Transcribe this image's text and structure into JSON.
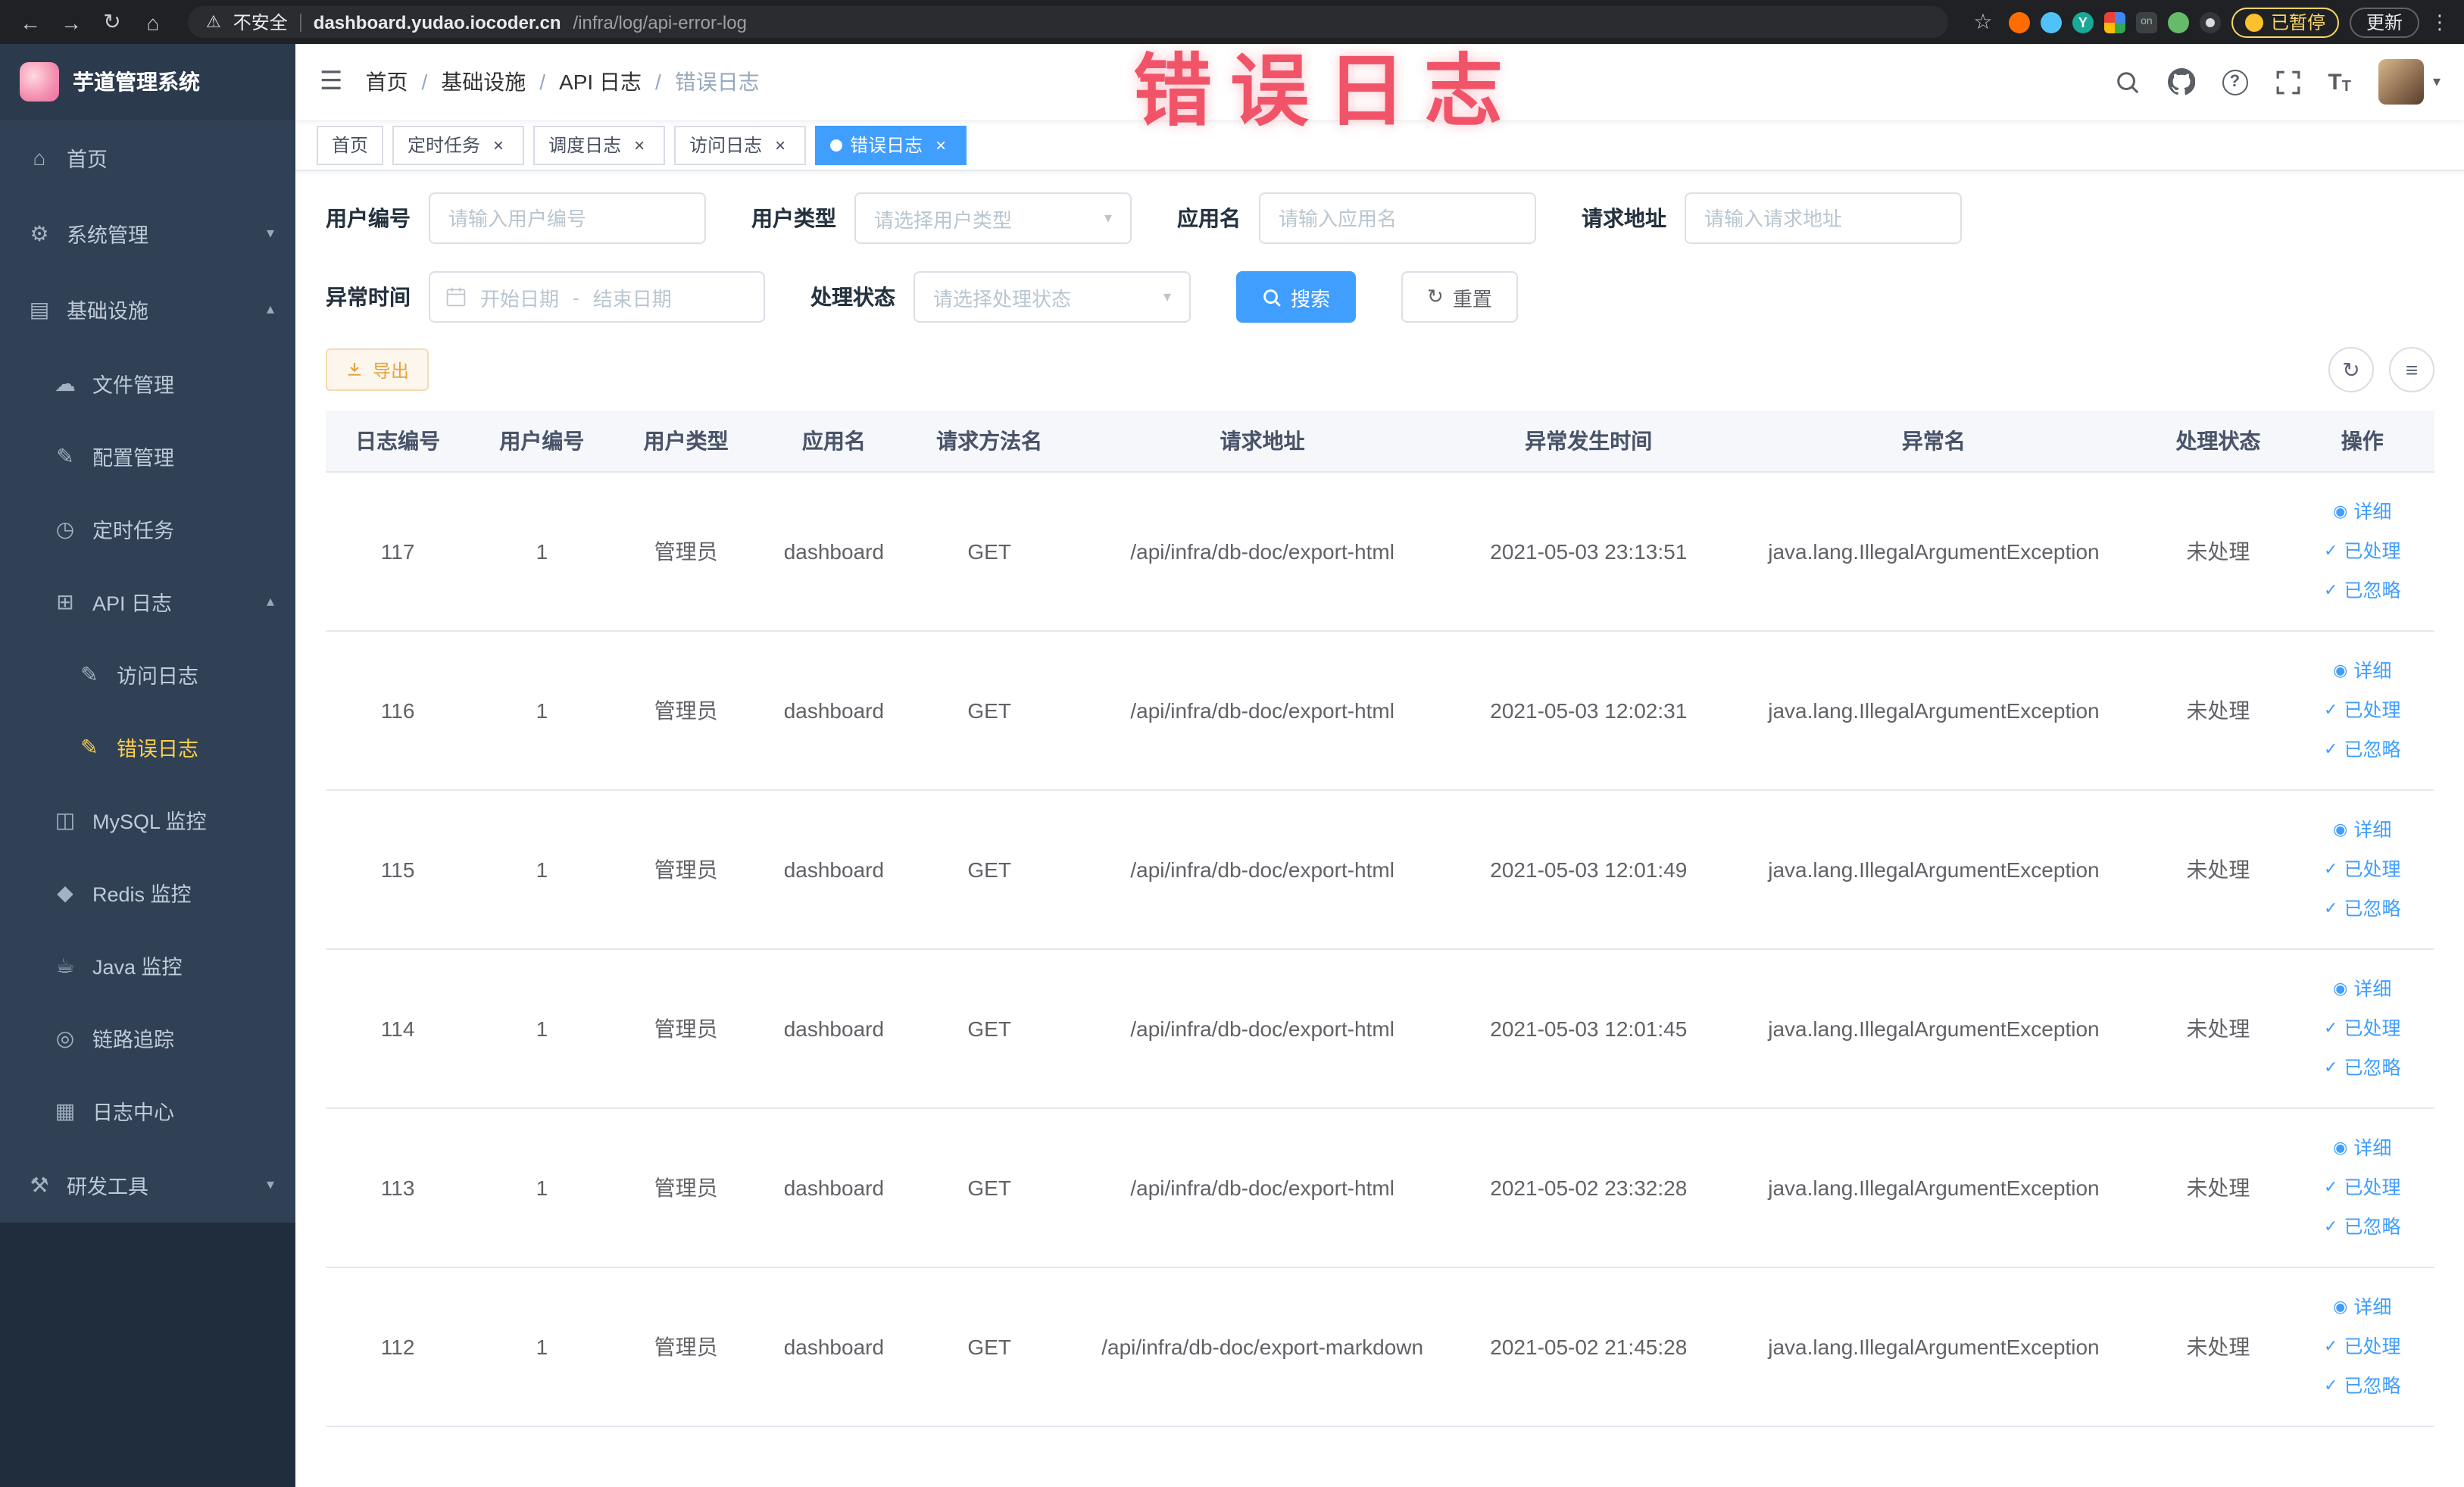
{
  "browser": {
    "security_label": "不安全",
    "url_host": "dashboard.yudao.iocoder.cn",
    "url_path": "/infra/log/api-error-log",
    "paused_label": "已暂停",
    "update_label": "更新",
    "extensions": {
      "teal_letter": "Y",
      "onetab_label": "on"
    }
  },
  "icons": {
    "back": "←",
    "forward": "→",
    "reload": "↻",
    "home": "⌂",
    "star": "☆",
    "warning": "⚠",
    "kebab": "⋮",
    "hamburger": "☰",
    "menu_home": "⌂",
    "menu_system": "⚙",
    "menu_infra": "▤",
    "menu_file": "☁",
    "menu_config": "✎",
    "menu_job": "◷",
    "menu_api_log": "⊞",
    "menu_access_log": "✎",
    "menu_error_log": "✎",
    "menu_mysql": "◫",
    "menu_redis": "◆",
    "menu_java": "☕",
    "menu_trace": "◎",
    "menu_log_center": "▦",
    "menu_dev_tools": "⚒",
    "chevron_down": "▾",
    "chevron_up": "▴",
    "caret_down": "▾",
    "question_mark": "?",
    "size_letter": "T",
    "refresh": "↻",
    "columns": "≡",
    "eye": "◉",
    "check": "✓",
    "close": "×",
    "separator": "/"
  },
  "sidebar": {
    "title": "芋道管理系统",
    "items": {
      "home": {
        "label": "首页"
      },
      "system": {
        "label": "系统管理"
      },
      "infra": {
        "label": "基础设施"
      },
      "file": {
        "label": "文件管理"
      },
      "config": {
        "label": "配置管理"
      },
      "job": {
        "label": "定时任务"
      },
      "api_log": {
        "label": "API 日志"
      },
      "access_log": {
        "label": "访问日志"
      },
      "error_log": {
        "label": "错误日志"
      },
      "mysql": {
        "label": "MySQL 监控"
      },
      "redis": {
        "label": "Redis 监控"
      },
      "java": {
        "label": "Java 监控"
      },
      "trace": {
        "label": "链路追踪"
      },
      "log_center": {
        "label": "日志中心"
      },
      "dev_tools": {
        "label": "研发工具"
      }
    }
  },
  "navbar": {
    "breadcrumb": [
      "首页",
      "基础设施",
      "API 日志",
      "错误日志"
    ]
  },
  "watermark": "错误日志",
  "tabs": [
    {
      "label": "首页",
      "closable": false,
      "active": false
    },
    {
      "label": "定时任务",
      "closable": true,
      "active": false
    },
    {
      "label": "调度日志",
      "closable": true,
      "active": false
    },
    {
      "label": "访问日志",
      "closable": true,
      "active": false
    },
    {
      "label": "错误日志",
      "closable": true,
      "active": true
    }
  ],
  "filters": {
    "user_id": {
      "label": "用户编号",
      "placeholder": "请输入用户编号"
    },
    "user_type": {
      "label": "用户类型",
      "placeholder": "请选择用户类型"
    },
    "app_name": {
      "label": "应用名",
      "placeholder": "请输入应用名"
    },
    "request_url": {
      "label": "请求地址",
      "placeholder": "请输入请求地址"
    },
    "time": {
      "label": "异常时间",
      "start_placeholder": "开始日期",
      "separator": "-",
      "end_placeholder": "结束日期"
    },
    "status": {
      "label": "处理状态",
      "placeholder": "请选择处理状态"
    },
    "search_label": "搜索",
    "reset_label": "重置"
  },
  "toolbar": {
    "export_label": "导出"
  },
  "row_actions": [
    "详细",
    "已处理",
    "已忽略"
  ],
  "table": {
    "columns": [
      "日志编号",
      "用户编号",
      "用户类型",
      "应用名",
      "请求方法名",
      "请求地址",
      "异常发生时间",
      "异常名",
      "处理状态",
      "操作"
    ],
    "rows": [
      {
        "id": "117",
        "user_id": "1",
        "user_type": "管理员",
        "app": "dashboard",
        "method": "GET",
        "url": "/api/infra/db-doc/export-html",
        "time": "2021-05-03 23:13:51",
        "exception": "java.lang.IllegalArgumentException",
        "status": "未处理"
      },
      {
        "id": "116",
        "user_id": "1",
        "user_type": "管理员",
        "app": "dashboard",
        "method": "GET",
        "url": "/api/infra/db-doc/export-html",
        "time": "2021-05-03 12:02:31",
        "exception": "java.lang.IllegalArgumentException",
        "status": "未处理"
      },
      {
        "id": "115",
        "user_id": "1",
        "user_type": "管理员",
        "app": "dashboard",
        "method": "GET",
        "url": "/api/infra/db-doc/export-html",
        "time": "2021-05-03 12:01:49",
        "exception": "java.lang.IllegalArgumentException",
        "status": "未处理"
      },
      {
        "id": "114",
        "user_id": "1",
        "user_type": "管理员",
        "app": "dashboard",
        "method": "GET",
        "url": "/api/infra/db-doc/export-html",
        "time": "2021-05-03 12:01:45",
        "exception": "java.lang.IllegalArgumentException",
        "status": "未处理"
      },
      {
        "id": "113",
        "user_id": "1",
        "user_type": "管理员",
        "app": "dashboard",
        "method": "GET",
        "url": "/api/infra/db-doc/export-html",
        "time": "2021-05-02 23:32:28",
        "exception": "java.lang.IllegalArgumentException",
        "status": "未处理"
      },
      {
        "id": "112",
        "user_id": "1",
        "user_type": "管理员",
        "app": "dashboard",
        "method": "GET",
        "url": "/api/infra/db-doc/export-markdown",
        "time": "2021-05-02 21:45:28",
        "exception": "java.lang.IllegalArgumentException",
        "status": "未处理"
      }
    ]
  }
}
